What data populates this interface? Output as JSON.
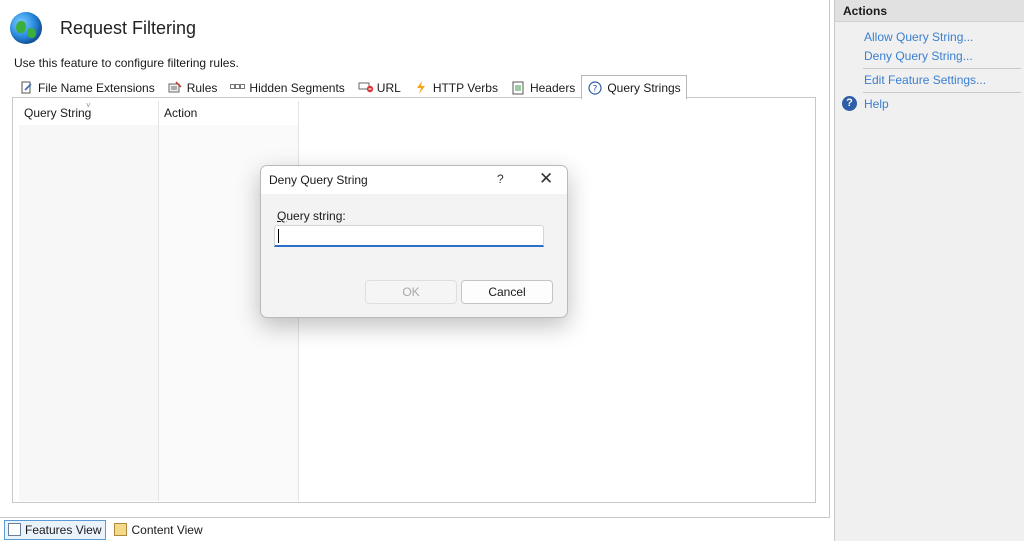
{
  "header": {
    "title": "Request Filtering",
    "description": "Use this feature to configure filtering rules."
  },
  "tabs": [
    {
      "label": "File Name Extensions",
      "icon": "document-edit-icon"
    },
    {
      "label": "Rules",
      "icon": "rules-icon"
    },
    {
      "label": "Hidden Segments",
      "icon": "hidden-segments-icon"
    },
    {
      "label": "URL",
      "icon": "url-deny-icon"
    },
    {
      "label": "HTTP Verbs",
      "icon": "lightning-icon"
    },
    {
      "label": "Headers",
      "icon": "headers-icon"
    },
    {
      "label": "Query Strings",
      "icon": "question-icon",
      "active": true
    }
  ],
  "grid": {
    "columns": [
      "Query String",
      "Action"
    ]
  },
  "viewbar": {
    "features_view": "Features View",
    "content_view": "Content View"
  },
  "actions": {
    "header": "Actions",
    "allow": "Allow Query String...",
    "deny": "Deny Query String...",
    "edit": "Edit Feature Settings...",
    "help": "Help"
  },
  "dialog": {
    "title": "Deny Query String",
    "help_glyph": "?",
    "label_underlined": "Q",
    "label_rest": "uery string:",
    "input_value": "",
    "ok": "OK",
    "cancel": "Cancel"
  },
  "colors": {
    "link": "#3a7fd0",
    "input_focus": "#2a6fc9"
  }
}
